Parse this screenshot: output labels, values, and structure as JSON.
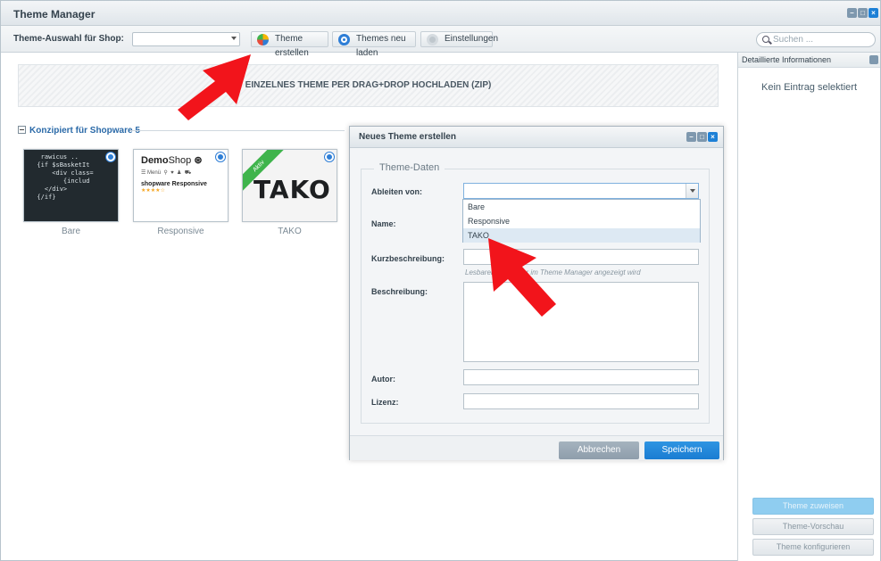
{
  "window": {
    "title": "Theme Manager"
  },
  "toolbar": {
    "shop_label": "Theme-Auswahl für Shop:",
    "shop_value": "",
    "create_label": "Theme erstellen",
    "reload_label": "Themes neu laden",
    "settings_label": "Einstellungen",
    "search_placeholder": "Suchen ..."
  },
  "upload": {
    "label": "EINZELNES THEME PER DRAG+DROP HOCHLADEN (ZIP)"
  },
  "group": {
    "label": "Konzipiert für Shopware 5"
  },
  "themes": [
    {
      "name": "Bare"
    },
    {
      "name": "Responsive",
      "brand_bold": "Demo",
      "brand_light": "Shop",
      "menu": "Menü",
      "product": "shopware Responsive"
    },
    {
      "name": "TAKO",
      "badge": "Aktiv"
    }
  ],
  "right_panel": {
    "header": "Detaillierte Informationen",
    "empty": "Kein Eintrag selektiert",
    "assign_button": "Theme zuweisen",
    "preview_button": "Theme-Vorschau",
    "configure_button": "Theme konfigurieren"
  },
  "dialog": {
    "title": "Neues Theme erstellen",
    "section": "Theme-Daten",
    "fields": {
      "derive_label": "Ableiten von:",
      "name_label": "Name:",
      "short_label": "Kurzbeschreibung:",
      "short_hint": "Lesbarer Name, der im Theme Manager angezeigt wird",
      "desc_label": "Beschreibung:",
      "author_label": "Autor:",
      "license_label": "Lizenz:"
    },
    "derive_options": [
      "Bare",
      "Responsive",
      "TAKO"
    ],
    "cancel": "Abbrechen",
    "save": "Speichern"
  },
  "colors": {
    "accent": "#1a7cd2",
    "arrow": "#f2141b",
    "active_badge": "#3fb44c"
  }
}
